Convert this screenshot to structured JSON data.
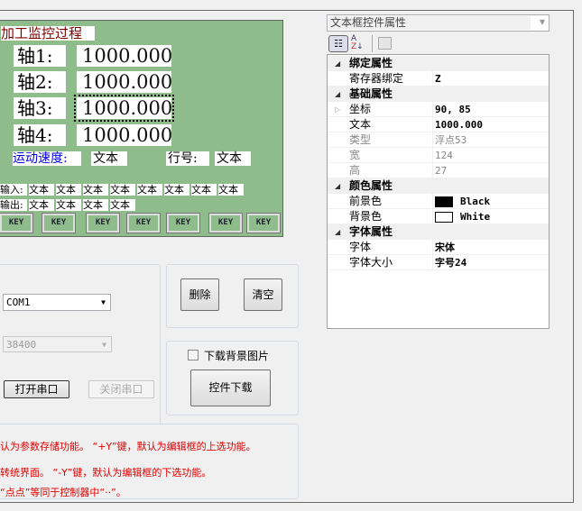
{
  "monitor": {
    "title": "加工监控过程",
    "axes": [
      {
        "label": "轴1:",
        "value": "1000.000"
      },
      {
        "label": "轴2:",
        "value": "1000.000"
      },
      {
        "label": "轴3:",
        "value": "1000.000"
      },
      {
        "label": "轴4:",
        "value": "1000.000"
      }
    ],
    "speed_label": "运动速度:",
    "speed_value": "文本",
    "line_label": "行号:",
    "line_value": "文本",
    "input_label": "输入:",
    "inputs": [
      "文本",
      "文本",
      "文本",
      "文本",
      "文本",
      "文本",
      "文本",
      "文本"
    ],
    "output_label": "输出:",
    "outputs": [
      "文本",
      "文本",
      "文本",
      "文本"
    ],
    "keys": [
      "KEY",
      "KEY",
      "KEY",
      "KEY",
      "KEY",
      "KEY",
      "KEY"
    ]
  },
  "serial": {
    "port": "COM1",
    "baud": "38400",
    "open": "打开串口",
    "close": "关闭串口"
  },
  "edit": {
    "delete": "删除",
    "clear": "清空"
  },
  "download": {
    "bg_checkbox": "下载背景图片",
    "bg_checked": false,
    "button": "控件下载"
  },
  "notes": [
    "认为参数存储功能。 “+Y”键，默认为编辑框的上选功能。",
    "转统界面。 “-Y”键，默认为编辑框的下选功能。",
    "“点点”等同于控制器中“··”。"
  ],
  "props": {
    "selector": "文本框控件属性",
    "rows": [
      {
        "type": "cat",
        "label": "绑定属性"
      },
      {
        "label": "寄存器绑定",
        "value": "Z"
      },
      {
        "type": "cat",
        "label": "基础属性"
      },
      {
        "label": "坐标",
        "value": "90, 85",
        "expand": true
      },
      {
        "label": "文本",
        "value": "1000.000"
      },
      {
        "label": "类型",
        "value": "浮点53",
        "disabled": true
      },
      {
        "label": "宽",
        "value": "124",
        "disabled": true
      },
      {
        "label": "高",
        "value": "27",
        "disabled": true
      },
      {
        "type": "cat",
        "label": "颜色属性"
      },
      {
        "label": "前景色",
        "value": "Black",
        "swatch": "#000000"
      },
      {
        "label": "背景色",
        "value": "White",
        "swatch": "#ffffff"
      },
      {
        "type": "cat",
        "label": "字体属性"
      },
      {
        "label": "字体",
        "value": "宋体"
      },
      {
        "label": "字体大小",
        "value": "字号24"
      }
    ]
  }
}
